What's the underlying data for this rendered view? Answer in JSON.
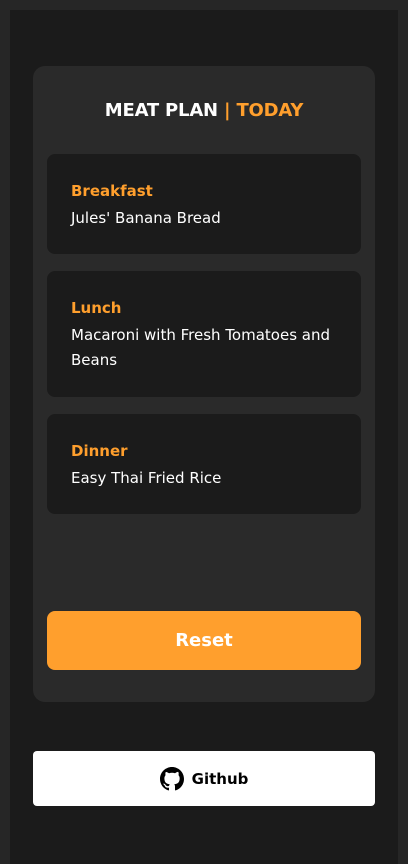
{
  "header": {
    "title": "MEAT PLAN",
    "separator": "|",
    "accent": "TODAY"
  },
  "meals": [
    {
      "label": "Breakfast",
      "name": "Jules' Banana Bread"
    },
    {
      "label": "Lunch",
      "name": "Macaroni with Fresh Tomatoes and Beans"
    },
    {
      "label": "Dinner",
      "name": "Easy Thai Fried Rice"
    }
  ],
  "actions": {
    "reset_label": "Reset",
    "github_label": "Github",
    "github_icon": "github-icon"
  },
  "colors": {
    "accent": "#ff9f2d",
    "background": "#1b1b1b",
    "card": "#2a2a2a"
  }
}
